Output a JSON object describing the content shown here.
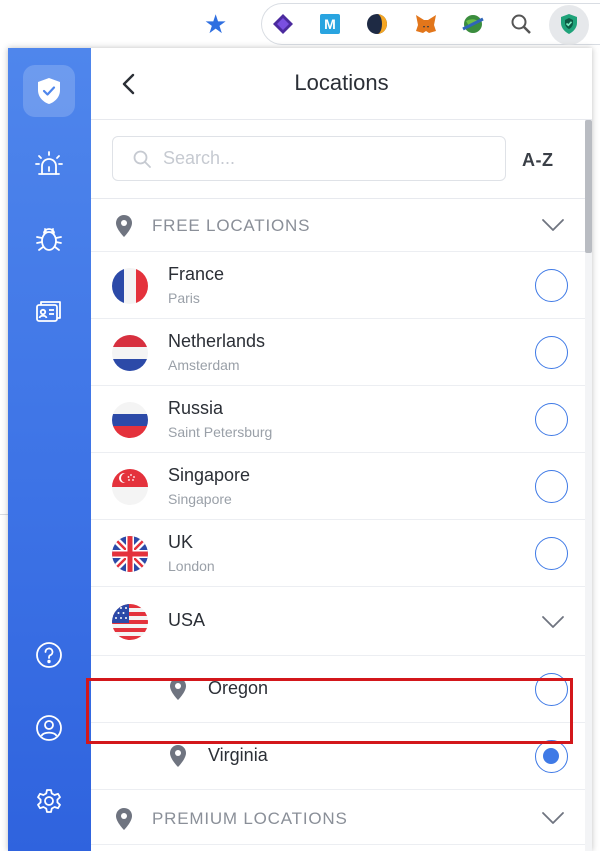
{
  "browser": {
    "star_icon": "star-icon",
    "extensions": [
      "purple-diamond-extension-icon",
      "m-extension-icon",
      "yellow-dark-extension-icon",
      "metamask-fox-icon",
      "globe-extension-icon",
      "magnifier-extension-icon",
      "vpn-shield-extension-icon"
    ]
  },
  "colors": {
    "accent": "#3f7ae6",
    "sidebar_top": "#4f86ec",
    "sidebar_bottom": "#2f63de",
    "highlight": "#d3171b"
  },
  "header": {
    "title": "Locations"
  },
  "search": {
    "placeholder": "Search...",
    "value": "",
    "sort_label": "A-Z"
  },
  "free_section": {
    "label": "FREE LOCATIONS"
  },
  "countries": [
    {
      "name": "France",
      "city": "Paris",
      "selected": false
    },
    {
      "name": "Netherlands",
      "city": "Amsterdam",
      "selected": false
    },
    {
      "name": "Russia",
      "city": "Saint Petersburg",
      "selected": false
    },
    {
      "name": "Singapore",
      "city": "Singapore",
      "selected": false
    },
    {
      "name": "UK",
      "city": "London",
      "selected": false
    }
  ],
  "usa": {
    "name": "USA",
    "locations": [
      {
        "name": "Oregon",
        "selected": false
      },
      {
        "name": "Virginia",
        "selected": true
      }
    ]
  },
  "premium_section": {
    "label": "PREMIUM LOCATIONS"
  },
  "sidebar": {
    "items": [
      "shield-icon",
      "siren-icon",
      "bug-icon",
      "id-card-icon",
      "help-icon",
      "account-icon",
      "settings-icon"
    ]
  }
}
